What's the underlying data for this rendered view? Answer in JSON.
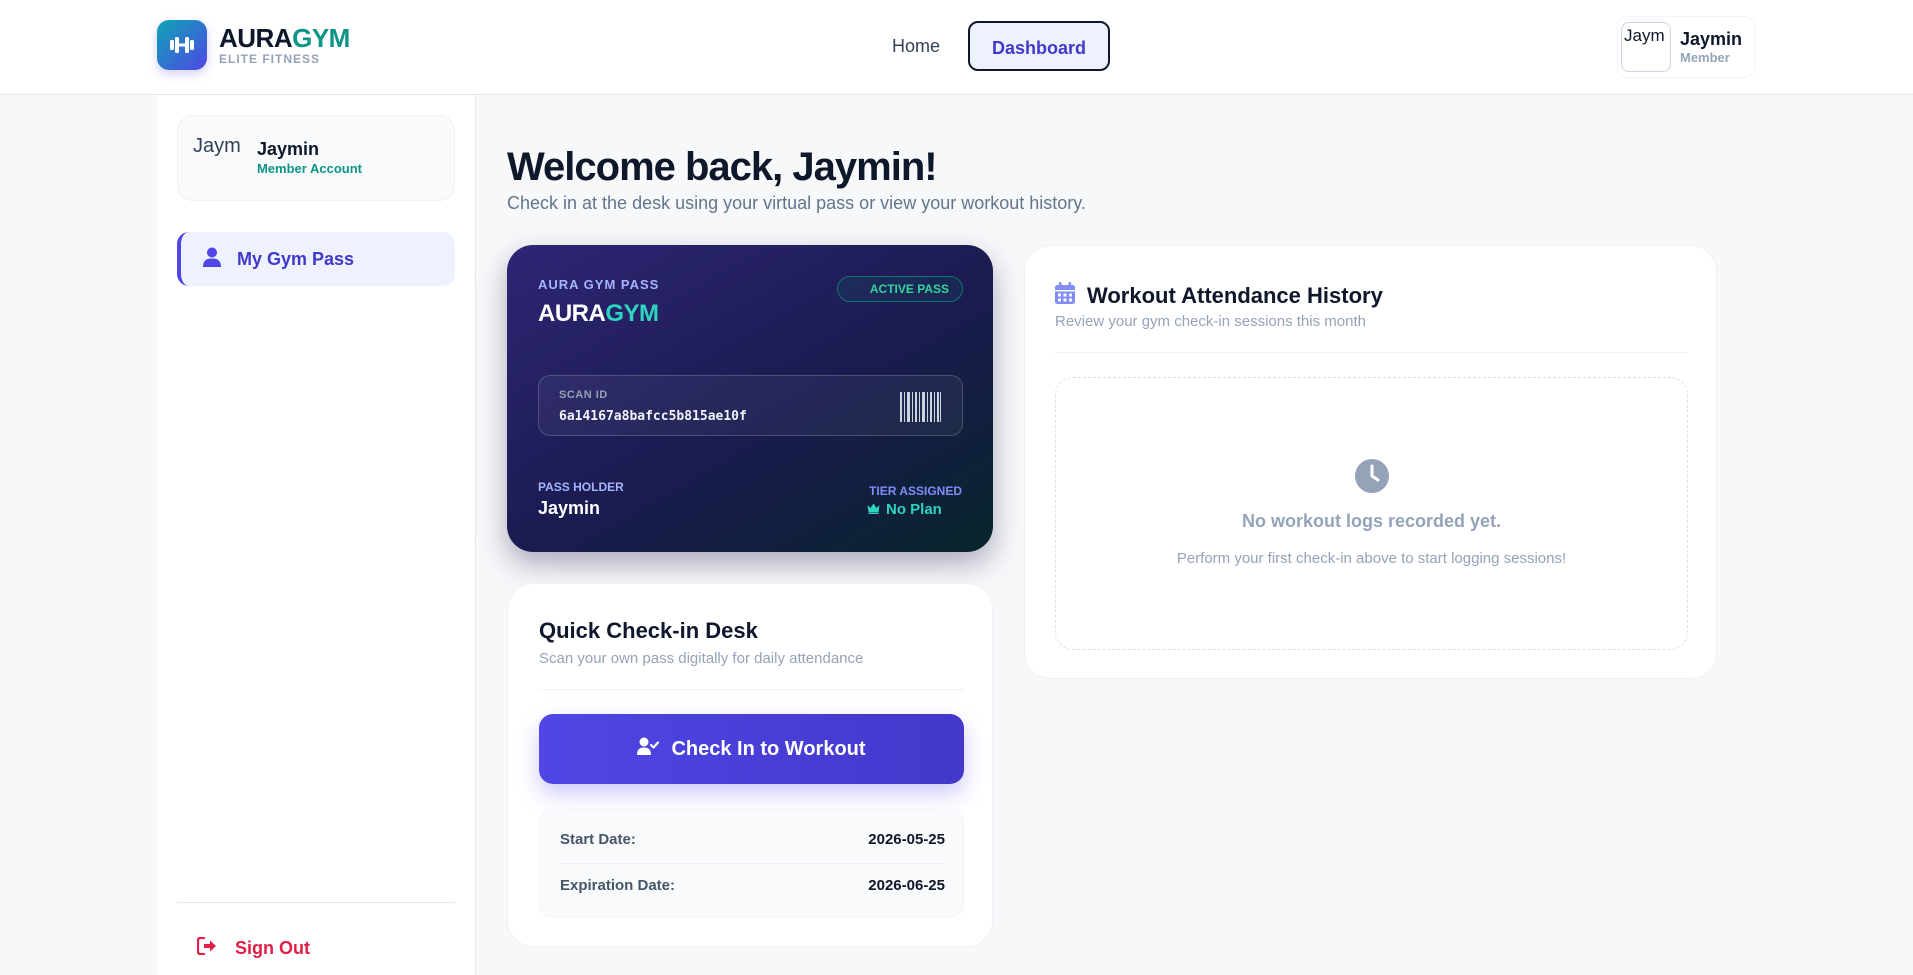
{
  "brand": {
    "name_part1": "AURA",
    "name_part2": "GYM",
    "tagline": "ELITE FITNESS",
    "logo_icon": "dumbbell-icon"
  },
  "nav": {
    "home_label": "Home",
    "dashboard_label": "Dashboard",
    "active": "Dashboard"
  },
  "header_user": {
    "avatar_alt": "Jaym",
    "name": "Jaymin",
    "role": "Member"
  },
  "sidebar": {
    "profile": {
      "avatar_alt": "Jaym",
      "name": "Jaymin",
      "role": "Member Account"
    },
    "items": [
      {
        "label": "My Gym Pass",
        "icon": "user-icon",
        "active": true
      }
    ],
    "signout_label": "Sign Out",
    "signout_icon": "sign-out-icon"
  },
  "main": {
    "welcome_title": "Welcome back, Jaymin!",
    "welcome_subtitle": "Check in at the desk using your virtual pass or view your workout history."
  },
  "pass": {
    "label": "AURA GYM PASS",
    "brand_part1": "AURA",
    "brand_part2": "GYM",
    "status_badge": "ACTIVE PASS",
    "scan_label": "SCAN ID",
    "scan_id": "6a14167a8bafcc5b815ae10f",
    "holder_label": "PASS HOLDER",
    "holder_name": "Jaymin",
    "tier_label": "TIER ASSIGNED",
    "tier_value": "No Plan",
    "tier_icon": "crown-icon"
  },
  "checkin": {
    "title": "Quick Check-in Desk",
    "subtitle": "Scan your own pass digitally for daily attendance",
    "button_label": "Check In to Workout",
    "button_icon": "user-check-icon",
    "start_date_label": "Start Date:",
    "start_date": "2026-05-25",
    "expiration_label": "Expiration Date:",
    "expiration_date": "2026-06-25"
  },
  "history": {
    "title": "Workout Attendance History",
    "subtitle": "Review your gym check-in sessions this month",
    "empty_title": "No workout logs recorded yet.",
    "empty_subtitle": "Perform your first check-in above to start logging sessions!",
    "icon": "calendar-icon",
    "empty_icon": "clock-icon"
  },
  "colors": {
    "primary": "#4f46e5",
    "accent_teal": "#0d9488",
    "danger": "#e11d48",
    "pass_bg_dark": "#1a1b4f"
  }
}
